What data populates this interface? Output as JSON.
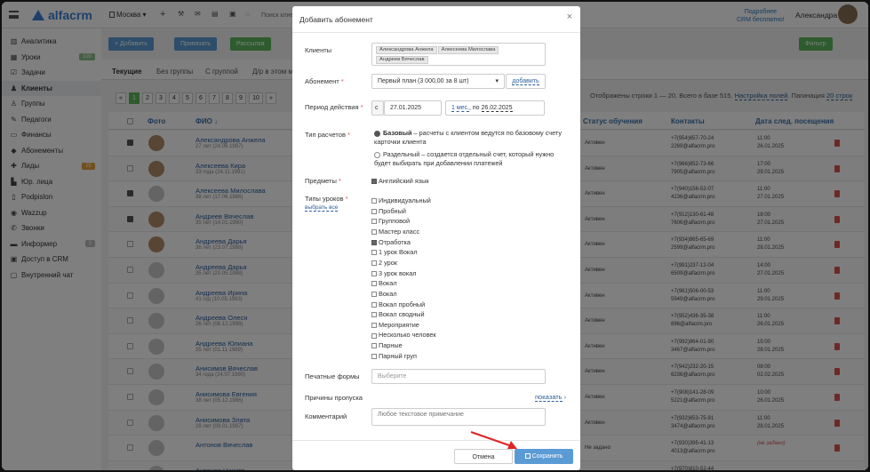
{
  "app": {
    "logo": "alfacrm",
    "branch": "Москва",
    "search_placeholder": "Поиск клие",
    "promo": [
      "Подробнее",
      "CRM бесплатно!"
    ],
    "user": "Александра"
  },
  "colors": {
    "primary": "#5b9bd5",
    "success": "#5cb85c",
    "danger": "#d9534f",
    "link": "#2b5d9a"
  },
  "sidebar": {
    "items": [
      {
        "label": "Аналитика",
        "icon": "chart-icon"
      },
      {
        "label": "Уроки",
        "icon": "calendar-icon",
        "badge": "100"
      },
      {
        "label": "Задачи",
        "icon": "tasks-icon"
      },
      {
        "label": "Клиенты",
        "icon": "user-icon",
        "active": true
      },
      {
        "label": "Группы",
        "icon": "users-icon"
      },
      {
        "label": "Педагоги",
        "icon": "teacher-icon"
      },
      {
        "label": "Финансы",
        "icon": "money-icon"
      },
      {
        "label": "Абонементы",
        "icon": "tag-icon"
      },
      {
        "label": "Лиды",
        "icon": "lead-icon",
        "badge": "25"
      },
      {
        "label": "Юр. лица",
        "icon": "building-icon"
      },
      {
        "label": "Podpislon",
        "icon": "doc-icon"
      },
      {
        "label": "Wazzup",
        "icon": "whatsapp-icon"
      },
      {
        "label": "Звонки",
        "icon": "phone-icon"
      },
      {
        "label": "Информер",
        "icon": "informer-icon",
        "badge": "3"
      },
      {
        "label": "Доступ в CRM",
        "icon": "lock-icon"
      },
      {
        "label": "Внутренний чат",
        "icon": "chat-icon"
      }
    ]
  },
  "toolbar": {
    "add": "+ Добавить",
    "link": "Привязать",
    "mailing": "Рассылка",
    "filter": "Фильтр"
  },
  "tabs": [
    "Текущие",
    "Без группы",
    "С группой",
    "Д/р в этом ме"
  ],
  "pagination": {
    "prev": "«",
    "pages": [
      "1",
      "2",
      "3",
      "4",
      "5",
      "6",
      "7",
      "8",
      "9",
      "10"
    ],
    "next": "»",
    "info_prefix": "Отображены строки 1 — 20. Всего в базе 515.",
    "settings": "Настройка полей",
    "page_size_label": "Пагинация",
    "page_size": "20 строк"
  },
  "table": {
    "headers": {
      "photo": "Фото",
      "name": "ФИО ↓",
      "status": "Статус обучения",
      "contacts": "Контакты",
      "next_visit": "Дата след. посещения"
    },
    "rows": [
      {
        "name": "Александрова Анжела",
        "sub": "27 лет (24.06.1997)",
        "checked": true,
        "photo": true,
        "status": "Активен",
        "phone": "+7(954)657-70-24",
        "email": "2269@alfacrm.pro",
        "time": "11:00",
        "date": "26.01.2025"
      },
      {
        "name": "Алексеева Кира",
        "sub": "33 года (24.11.1991)",
        "checked": false,
        "photo": true,
        "status": "Активен",
        "phone": "+7(966)852-73-66",
        "email": "7905@alfacrm.pro",
        "time": "17:00",
        "date": "29.01.2025"
      },
      {
        "name": "Алексеева Милослава",
        "sub": "38 лет (17.06.1986)",
        "checked": true,
        "photo": false,
        "status": "Активен",
        "phone": "+7(940)156-52-07",
        "email": "4236@alfacrm.pro",
        "time": "11:00",
        "date": "27.01.2025"
      },
      {
        "name": "Андреев Вячеслав",
        "sub": "35 лет (14.01.1990)",
        "checked": true,
        "photo": true,
        "status": "Активен",
        "phone": "+7(912)130-61-48",
        "email": "7606@alfacrm.pro",
        "time": "18:00",
        "date": "27.01.2025"
      },
      {
        "name": "Андреева Дарья",
        "sub": "36 лет (23.07.1988)",
        "checked": false,
        "photo": true,
        "status": "Активен",
        "phone": "+7(934)865-65-69",
        "email": "2599@alfacrm.pro",
        "time": "11:00",
        "date": "28.01.2025"
      },
      {
        "name": "Андреева Дарья",
        "sub": "35 лет (20.05.1988)",
        "checked": false,
        "photo": false,
        "status": "Активен",
        "phone": "+7(991)237-12-04",
        "email": "6509@alfacrm.pro",
        "time": "14:00",
        "date": "27.01.2025"
      },
      {
        "name": "Андреева Ирина",
        "sub": "41 год (10.05.1983)",
        "checked": false,
        "photo": false,
        "status": "Активен",
        "phone": "+7(961)506-00-53",
        "email": "5949@alfacrm.pro",
        "time": "11:00",
        "date": "29.01.2025"
      },
      {
        "name": "Андреева Олеся",
        "sub": "26 лет (06.12.1998)",
        "checked": false,
        "photo": false,
        "status": "Активен",
        "phone": "+7(952)436-35-38",
        "email": "896@alfacrm.pro",
        "time": "11:00",
        "date": "26.01.2025"
      },
      {
        "name": "Андреева Юлиана",
        "sub": "35 лет (01.11.1989)",
        "checked": false,
        "photo": false,
        "status": "Активен",
        "phone": "+7(992)864-01-90",
        "email": "3467@alfacrm.pro",
        "time": "15:00",
        "date": "28.01.2025"
      },
      {
        "name": "Анисимов Вячеслав",
        "sub": "34 года (24.07.1990)",
        "checked": false,
        "photo": false,
        "status": "Активен",
        "phone": "+7(942)232-20-15",
        "email": "6236@alfacrm.pro",
        "time": "08:00",
        "date": "02.02.2025"
      },
      {
        "name": "Анисимова Евгения",
        "sub": "38 лет (05.12.1986)",
        "checked": false,
        "photo": false,
        "status": "Активен",
        "phone": "+7(908)141-28-09",
        "email": "5221@alfacrm.pro",
        "time": "10:00",
        "date": "26.01.2025"
      },
      {
        "name": "Анисимова Злата",
        "sub": "28 лет (09.01.1997)",
        "checked": false,
        "photo": false,
        "status": "Активен",
        "phone": "+7(932)653-75-91",
        "email": "3474@alfacrm.pro",
        "time": "11:00",
        "date": "28.01.2025"
      },
      {
        "name": "Антонов Вячеслав",
        "sub": "",
        "checked": false,
        "photo": false,
        "status": "Не задано",
        "phone": "+7(930)395-41-13",
        "email": "4013@alfacrm.pro",
        "time": "(не задано)",
        "date": ""
      },
      {
        "name": "Антонов Никита",
        "sub": "",
        "checked": false,
        "photo": false,
        "status": "",
        "phone": "+7(970)810-52-44",
        "email": "",
        "time": "",
        "date": ""
      }
    ]
  },
  "modal": {
    "title": "Добавить абонемент",
    "close": "×",
    "clients_label": "Клиенты",
    "clients": [
      "Александрова Анжела",
      "Алексеева Милослава",
      "Андреев Вячеслав"
    ],
    "subscription_label": "Абонемент",
    "subscription_value": "Первый план (3 000,00 за 8 шт)",
    "subscription_add": "добавить",
    "period_label": "Период действия",
    "period_from_prefix": "с",
    "period_from": "27.01.2025",
    "period_length": "1 мес.",
    "period_to_prefix": "по",
    "period_to": "26.02.2025",
    "calc_label": "Тип расчетов",
    "calc_base_title": "Базовый",
    "calc_base_text": " – расчеты с клиентом ведутся по базовому счету карточки клиента",
    "calc_sep_title": "Раздельный",
    "calc_sep_text": " – создается отдельный счет, который нужно будет выбирать при добавлении платежей",
    "subjects_label": "Предметы",
    "subject": "Английский язык",
    "lesson_types_label": "Типы уроков",
    "select_all": "выбрать все",
    "lesson_types": [
      {
        "label": "Индивидуальный",
        "checked": false
      },
      {
        "label": "Пробный",
        "checked": false
      },
      {
        "label": "Групповой",
        "checked": false
      },
      {
        "label": "Мастер класс",
        "checked": false
      },
      {
        "label": "Отработка",
        "checked": true
      },
      {
        "label": "1 урок Вокал",
        "checked": false
      },
      {
        "label": "2 урок",
        "checked": false
      },
      {
        "label": "3 урок вокал",
        "checked": false
      },
      {
        "label": "Вокал",
        "checked": false
      },
      {
        "label": "Вокал",
        "checked": false
      },
      {
        "label": "Вокал пробный",
        "checked": false
      },
      {
        "label": "Вокал сводный",
        "checked": false
      },
      {
        "label": "Мероприятие",
        "checked": false
      },
      {
        "label": "Несколько человек",
        "checked": false
      },
      {
        "label": "Парные",
        "checked": false
      },
      {
        "label": "Парный груп",
        "checked": false
      }
    ],
    "print_forms_label": "Печатные формы",
    "print_forms_placeholder": "Выберите",
    "skip_reasons_label": "Причины пропуска",
    "skip_reasons_link": "показать",
    "comment_label": "Комментарий",
    "comment_placeholder": "Любое текстовое примечание",
    "cancel": "Отмена",
    "save": "Сохранить"
  }
}
